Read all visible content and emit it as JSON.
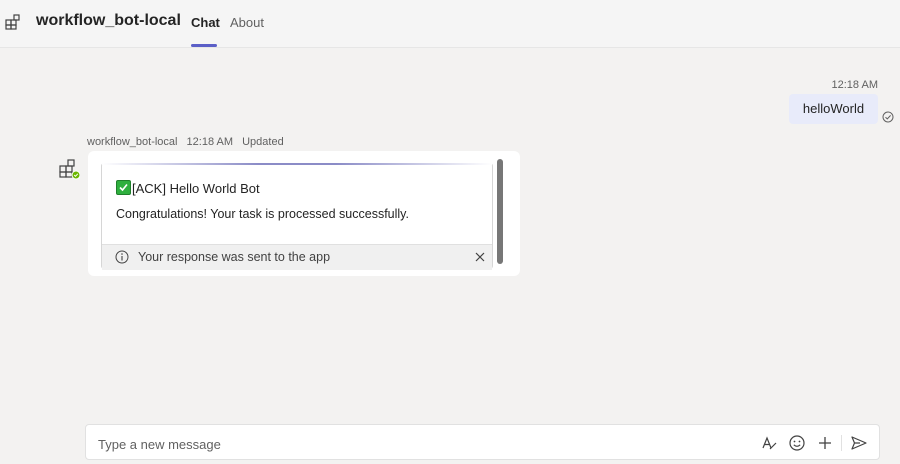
{
  "header": {
    "app_title": "workflow_bot-local",
    "tabs": [
      {
        "label": "Chat",
        "active": true
      },
      {
        "label": "About",
        "active": false
      }
    ],
    "accent_color": "#5b5fc7"
  },
  "conversation": {
    "outgoing": {
      "time": "12:18 AM",
      "text": "helloWorld",
      "status_icon": "read-receipt-icon"
    },
    "incoming": {
      "sender": "workflow_bot-local",
      "time": "12:18 AM",
      "edited_label": "Updated",
      "card": {
        "title_prefix_icon": "check-mark-button-icon",
        "title": "[ACK] Hello World Bot",
        "body": "Congratulations! Your task is processed successfully.",
        "footer": "Your response was sent to the app"
      }
    }
  },
  "compose": {
    "placeholder": "Type a new message",
    "tools": [
      "format-icon",
      "emoji-icon",
      "add-icon",
      "send-icon"
    ]
  }
}
